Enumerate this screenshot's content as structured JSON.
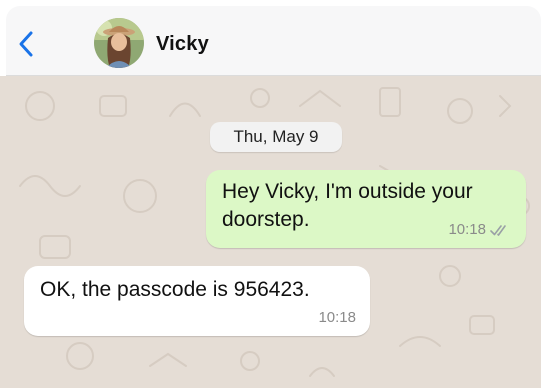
{
  "header": {
    "contact_name": "Vicky",
    "back_icon": "chevron-left-icon",
    "avatar_icon": "contact-photo",
    "accent_color": "#1a73e8"
  },
  "chat": {
    "date_label": "Thu, May 9",
    "background_color": "#e5ddd5",
    "messages": [
      {
        "direction": "outgoing",
        "text": "Hey Vicky, I'm outside your doorstep.",
        "time": "10:18",
        "status_icon": "double-check-icon",
        "bubble_color": "#dcf8c6"
      },
      {
        "direction": "incoming",
        "text": "OK, the passcode is 956423.",
        "time": "10:18",
        "bubble_color": "#ffffff"
      }
    ]
  }
}
